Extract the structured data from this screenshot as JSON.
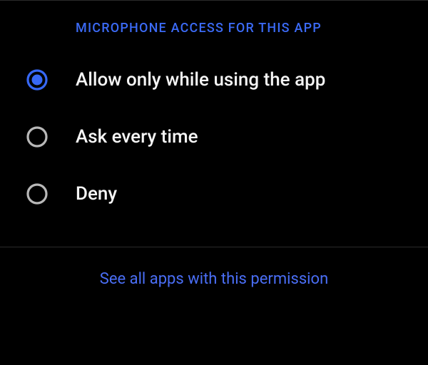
{
  "header": {
    "title": "MICROPHONE ACCESS FOR THIS APP"
  },
  "options": [
    {
      "label": "Allow only while using the app",
      "selected": true
    },
    {
      "label": "Ask every time",
      "selected": false
    },
    {
      "label": "Deny",
      "selected": false
    }
  ],
  "footer": {
    "link_label": "See all apps with this permission"
  },
  "colors": {
    "accent": "#3768f5",
    "unselected": "#b8b8b8"
  }
}
